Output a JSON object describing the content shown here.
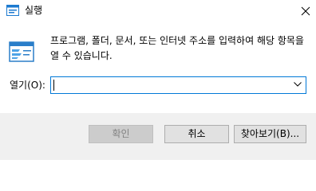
{
  "window": {
    "title": "실행",
    "close_symbol": "✕"
  },
  "description": "프로그램, 폴더, 문서, 또는 인터넷 주소를 입력하여 해당 항목을 열 수 있습니다.",
  "open": {
    "label": "열기(O):",
    "value": "",
    "dropdown_icon": "chevron-down-icon"
  },
  "buttons": {
    "ok": "확인",
    "cancel": "취소",
    "browse": "찾아보기(B)..."
  },
  "colors": {
    "focus_border": "#0078d7",
    "footer_bg": "#f0f0f0",
    "button_bg": "#e1e1e1",
    "disabled_bg": "#cccccc",
    "disabled_text": "#838383"
  }
}
